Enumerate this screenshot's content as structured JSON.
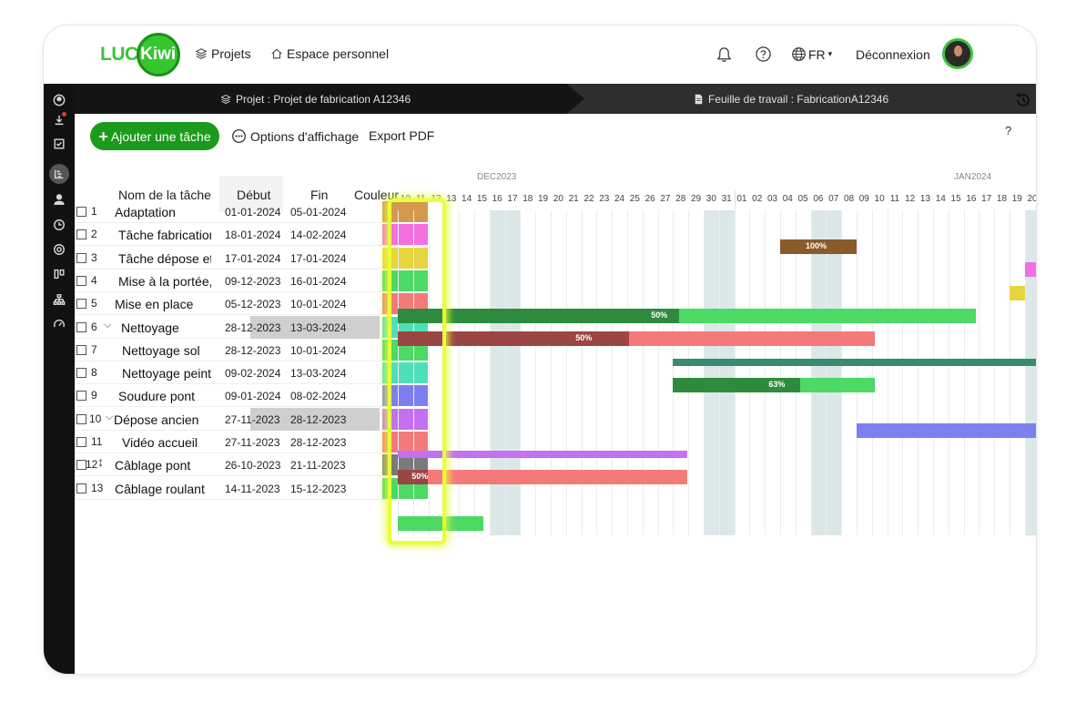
{
  "app": {
    "logo_text_1": "LUC",
    "logo_text_2": "Kiwi"
  },
  "nav": {
    "projects": "Projets",
    "personal_space": "Espace personnel",
    "language": "FR",
    "logout": "Déconnexion"
  },
  "project_bar": {
    "project": "Projet : Projet de fabrication A12346",
    "worksheet": "Feuille de travail : FabricationA12346"
  },
  "toolbar": {
    "add_task": "Ajouter une tâche",
    "display_options": "Options d'affichage",
    "export_pdf": "Export PDF",
    "help": "?"
  },
  "table": {
    "headers": {
      "name": "Nom de la tâche",
      "start": "Début",
      "end": "Fin",
      "color": "Couleur"
    },
    "rows": [
      {
        "num": "1",
        "name": "Adaptation",
        "start": "01-01-2024",
        "end": "05-01-2024",
        "color": "#d4994f"
      },
      {
        "num": "2",
        "name": "Tâche fabrication",
        "start": "18-01-2024",
        "end": "14-02-2024",
        "color": "#f46fe0"
      },
      {
        "num": "3",
        "name": "Tâche dépose et",
        "start": "17-01-2024",
        "end": "17-01-2024",
        "color": "#e8d43c"
      },
      {
        "num": "4",
        "name": "Mise à la portée,",
        "start": "09-12-2023",
        "end": "16-01-2024",
        "color": "#4cd964"
      },
      {
        "num": "5",
        "name": "Mise en place",
        "start": "05-12-2023",
        "end": "10-01-2024",
        "color": "#f47a7a"
      },
      {
        "num": "6",
        "name": "Nettoyage",
        "start": "28-12-2023",
        "end": "13-03-2024",
        "color": "#4fdfb8"
      },
      {
        "num": "7",
        "name": "Nettoyage sol",
        "start": "28-12-2023",
        "end": "10-01-2024",
        "color": "#4cd964"
      },
      {
        "num": "8",
        "name": "Nettoyage peint",
        "start": "09-02-2024",
        "end": "13-03-2024",
        "color": "#4fdfb8"
      },
      {
        "num": "9",
        "name": "Soudure pont",
        "start": "09-01-2024",
        "end": "08-02-2024",
        "color": "#7d7ff0"
      },
      {
        "num": "10",
        "name": "Dépose ancien",
        "start": "27-11-2023",
        "end": "28-12-2023",
        "color": "#c470f0"
      },
      {
        "num": "11",
        "name": "Vidéo accueil",
        "start": "27-11-2023",
        "end": "28-12-2023",
        "color": "#f47a7a"
      },
      {
        "num": "12",
        "name": "Câblage pont",
        "start": "26-10-2023",
        "end": "21-11-2023",
        "color": "#7a7a7a"
      },
      {
        "num": "13",
        "name": "Câblage roulant",
        "start": "14-11-2023",
        "end": "15-12-2023",
        "color": "#4cd964"
      }
    ]
  },
  "gantt": {
    "months": [
      "DEC2023",
      "JAN2024"
    ],
    "days": [
      "10",
      "11",
      "12",
      "13",
      "14",
      "15",
      "16",
      "17",
      "18",
      "19",
      "20",
      "21",
      "22",
      "23",
      "24",
      "25",
      "26",
      "27",
      "28",
      "29",
      "30",
      "31",
      "01",
      "02",
      "03",
      "04",
      "05",
      "06",
      "07",
      "08",
      "09",
      "10",
      "11",
      "12",
      "13",
      "14",
      "15",
      "16",
      "17",
      "18",
      "19",
      "20"
    ],
    "progress_labels": {
      "row1": "100%",
      "row4": "50%",
      "row5": "50%",
      "row7": "63%",
      "row11": "50%"
    }
  }
}
